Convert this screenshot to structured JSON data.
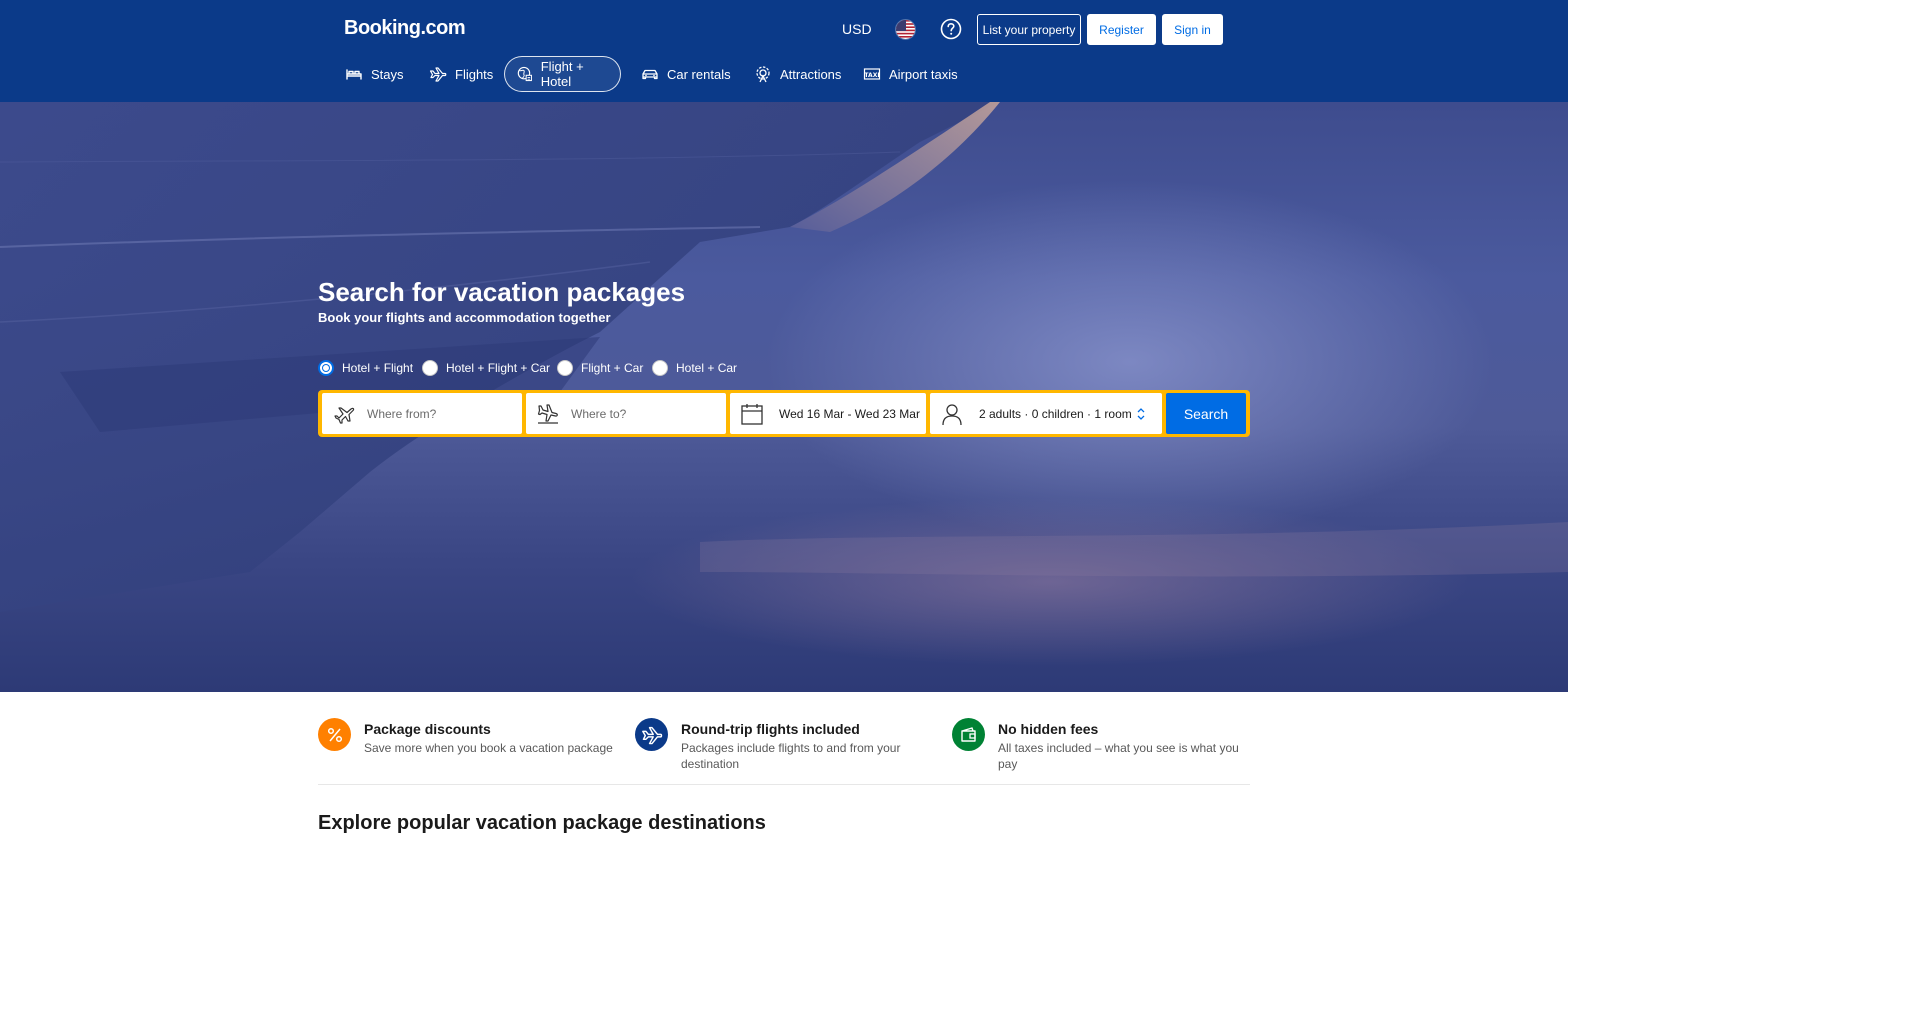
{
  "header": {
    "logo": "Booking.com",
    "currency": "USD",
    "list_property": "List your property",
    "register": "Register",
    "sign_in": "Sign in"
  },
  "nav": [
    {
      "label": "Stays",
      "icon": "bed-icon"
    },
    {
      "label": "Flights",
      "icon": "plane-icon"
    },
    {
      "label": "Flight + Hotel",
      "icon": "globe-icon",
      "active": true
    },
    {
      "label": "Car rentals",
      "icon": "car-icon"
    },
    {
      "label": "Attractions",
      "icon": "attractions-icon"
    },
    {
      "label": "Airport taxis",
      "icon": "taxi-icon"
    }
  ],
  "hero": {
    "title": "Search for vacation packages",
    "subtitle": "Book your flights and accommodation together"
  },
  "package_types": [
    {
      "label": "Hotel + Flight",
      "checked": true
    },
    {
      "label": "Hotel + Flight + Car",
      "checked": false
    },
    {
      "label": "Flight + Car",
      "checked": false
    },
    {
      "label": "Hotel + Car",
      "checked": false
    }
  ],
  "search": {
    "from_placeholder": "Where from?",
    "to_placeholder": "Where to?",
    "dates": "Wed 16 Mar - Wed 23 Mar",
    "occupancy": "2 adults · 0 children · 1 room",
    "button": "Search"
  },
  "features": [
    {
      "title": "Package discounts",
      "desc": "Save more when you book a vacation package",
      "icon": "percent-icon",
      "color": "#ff8000"
    },
    {
      "title": "Round-trip flights included",
      "desc": "Packages include flights to and from your destination",
      "icon": "plane-icon",
      "color": "#0b3a89"
    },
    {
      "title": "No hidden fees",
      "desc": "All taxes included – what you see is what you pay",
      "icon": "wallet-icon",
      "color": "#008234"
    }
  ],
  "section_title": "Explore popular vacation package destinations",
  "colors": {
    "brand_blue": "#0b3a89",
    "action_blue": "#006ce4",
    "search_border": "#ffb700"
  }
}
